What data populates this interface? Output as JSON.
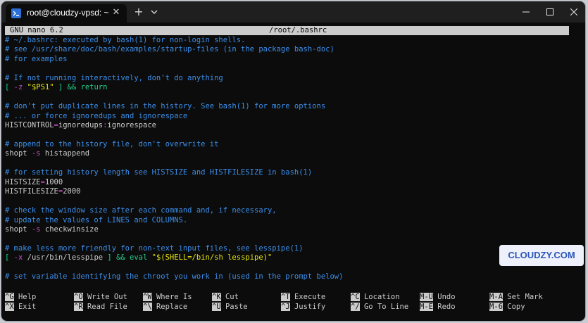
{
  "window": {
    "tab_title": "root@cloudzy-vpsd: ~",
    "tab_close": "✕",
    "new_tab": "+"
  },
  "editor": {
    "app": "GNU nano 6.2",
    "file": "/root/.bashrc"
  },
  "lines": [
    [
      {
        "t": "# ~/.bashrc: executed by bash(1) for non-login shells.",
        "c": "cm"
      }
    ],
    [
      {
        "t": "# see /usr/share/doc/bash/examples/startup-files (in the package bash-doc)",
        "c": "cm"
      }
    ],
    [
      {
        "t": "# for examples",
        "c": "cm"
      }
    ],
    [],
    [
      {
        "t": "# If not running interactively, don't do anything",
        "c": "cm"
      }
    ],
    [
      {
        "t": "[ ",
        "c": "kw"
      },
      {
        "t": "-z",
        "c": "op"
      },
      {
        "t": " ",
        "c": ""
      },
      {
        "t": "\"$PS1\"",
        "c": "st"
      },
      {
        "t": " ] && return",
        "c": "kw"
      }
    ],
    [],
    [
      {
        "t": "# don't put duplicate lines in the history. See bash(1) for more options",
        "c": "cm"
      }
    ],
    [
      {
        "t": "# ... or force ignoredups and ignorespace",
        "c": "cm"
      }
    ],
    [
      {
        "t": "HISTCONTROL",
        "c": ""
      },
      {
        "t": "=",
        "c": "op"
      },
      {
        "t": "ignoredups",
        "c": ""
      },
      {
        "t": ":",
        "c": "op"
      },
      {
        "t": "ignorespace",
        "c": ""
      }
    ],
    [],
    [
      {
        "t": "# append to the history file, don't overwrite it",
        "c": "cm"
      }
    ],
    [
      {
        "t": "shopt ",
        "c": ""
      },
      {
        "t": "-s",
        "c": "op"
      },
      {
        "t": " histappend",
        "c": ""
      }
    ],
    [],
    [
      {
        "t": "# for setting history length see HISTSIZE and HISTFILESIZE in bash(1)",
        "c": "cm"
      }
    ],
    [
      {
        "t": "HISTSIZE",
        "c": ""
      },
      {
        "t": "=",
        "c": "op"
      },
      {
        "t": "1000",
        "c": ""
      }
    ],
    [
      {
        "t": "HISTFILESIZE",
        "c": ""
      },
      {
        "t": "=",
        "c": "op"
      },
      {
        "t": "2000",
        "c": ""
      }
    ],
    [],
    [
      {
        "t": "# check the window size after each command and, if necessary,",
        "c": "cm"
      }
    ],
    [
      {
        "t": "# update the values of LINES and COLUMNS.",
        "c": "cm"
      }
    ],
    [
      {
        "t": "shopt ",
        "c": ""
      },
      {
        "t": "-s",
        "c": "op"
      },
      {
        "t": " checkwinsize",
        "c": ""
      }
    ],
    [],
    [
      {
        "t": "# make less more friendly for non-text input files, see lesspipe(1)",
        "c": "cm"
      }
    ],
    [
      {
        "t": "[ ",
        "c": "kw"
      },
      {
        "t": "-x",
        "c": "op"
      },
      {
        "t": " /usr/bin/lesspipe ",
        "c": ""
      },
      {
        "t": "] && eval ",
        "c": "kw"
      },
      {
        "t": "\"$(SHELL=/bin/sh lesspipe)\"",
        "c": "st"
      }
    ],
    [],
    [
      {
        "t": "# set variable identifying the chroot you work in (used in the prompt below)",
        "c": "cm"
      }
    ]
  ],
  "shortcuts": [
    [
      {
        "key": "^G",
        "label": "Help"
      },
      {
        "key": "^O",
        "label": "Write Out"
      },
      {
        "key": "^W",
        "label": "Where Is"
      },
      {
        "key": "^K",
        "label": "Cut"
      },
      {
        "key": "^T",
        "label": "Execute"
      },
      {
        "key": "^C",
        "label": "Location"
      },
      {
        "key": "M-U",
        "label": "Undo"
      },
      {
        "key": "M-A",
        "label": "Set Mark"
      }
    ],
    [
      {
        "key": "^X",
        "label": "Exit"
      },
      {
        "key": "^R",
        "label": "Read File"
      },
      {
        "key": "^\\",
        "label": "Replace"
      },
      {
        "key": "^U",
        "label": "Paste"
      },
      {
        "key": "^J",
        "label": "Justify"
      },
      {
        "key": "^/",
        "label": "Go To Line"
      },
      {
        "key": "M-E",
        "label": "Redo"
      },
      {
        "key": "M-6",
        "label": "Copy"
      }
    ]
  ],
  "watermark": "CLOUDZY.COM",
  "colors": {
    "background": "#0c0c0c",
    "comment": "#3b8eea",
    "operator": "#c14fc1",
    "string": "#e5e510",
    "keyword": "#23d18b",
    "text": "#cccccc"
  }
}
